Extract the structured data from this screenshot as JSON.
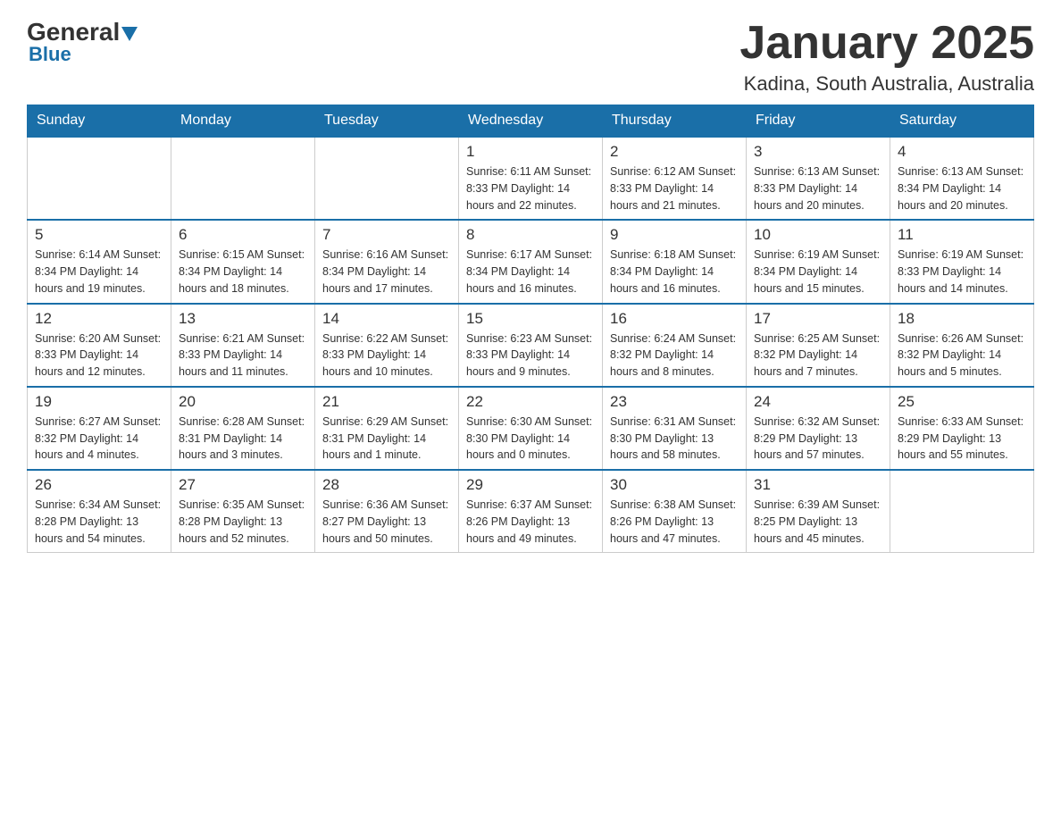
{
  "header": {
    "logo_general": "General",
    "logo_blue": "Blue",
    "title": "January 2025",
    "subtitle": "Kadina, South Australia, Australia"
  },
  "days_of_week": [
    "Sunday",
    "Monday",
    "Tuesday",
    "Wednesday",
    "Thursday",
    "Friday",
    "Saturday"
  ],
  "weeks": [
    {
      "cells": [
        {
          "day": "",
          "info": ""
        },
        {
          "day": "",
          "info": ""
        },
        {
          "day": "",
          "info": ""
        },
        {
          "day": "1",
          "info": "Sunrise: 6:11 AM\nSunset: 8:33 PM\nDaylight: 14 hours\nand 22 minutes."
        },
        {
          "day": "2",
          "info": "Sunrise: 6:12 AM\nSunset: 8:33 PM\nDaylight: 14 hours\nand 21 minutes."
        },
        {
          "day": "3",
          "info": "Sunrise: 6:13 AM\nSunset: 8:33 PM\nDaylight: 14 hours\nand 20 minutes."
        },
        {
          "day": "4",
          "info": "Sunrise: 6:13 AM\nSunset: 8:34 PM\nDaylight: 14 hours\nand 20 minutes."
        }
      ]
    },
    {
      "cells": [
        {
          "day": "5",
          "info": "Sunrise: 6:14 AM\nSunset: 8:34 PM\nDaylight: 14 hours\nand 19 minutes."
        },
        {
          "day": "6",
          "info": "Sunrise: 6:15 AM\nSunset: 8:34 PM\nDaylight: 14 hours\nand 18 minutes."
        },
        {
          "day": "7",
          "info": "Sunrise: 6:16 AM\nSunset: 8:34 PM\nDaylight: 14 hours\nand 17 minutes."
        },
        {
          "day": "8",
          "info": "Sunrise: 6:17 AM\nSunset: 8:34 PM\nDaylight: 14 hours\nand 16 minutes."
        },
        {
          "day": "9",
          "info": "Sunrise: 6:18 AM\nSunset: 8:34 PM\nDaylight: 14 hours\nand 16 minutes."
        },
        {
          "day": "10",
          "info": "Sunrise: 6:19 AM\nSunset: 8:34 PM\nDaylight: 14 hours\nand 15 minutes."
        },
        {
          "day": "11",
          "info": "Sunrise: 6:19 AM\nSunset: 8:33 PM\nDaylight: 14 hours\nand 14 minutes."
        }
      ]
    },
    {
      "cells": [
        {
          "day": "12",
          "info": "Sunrise: 6:20 AM\nSunset: 8:33 PM\nDaylight: 14 hours\nand 12 minutes."
        },
        {
          "day": "13",
          "info": "Sunrise: 6:21 AM\nSunset: 8:33 PM\nDaylight: 14 hours\nand 11 minutes."
        },
        {
          "day": "14",
          "info": "Sunrise: 6:22 AM\nSunset: 8:33 PM\nDaylight: 14 hours\nand 10 minutes."
        },
        {
          "day": "15",
          "info": "Sunrise: 6:23 AM\nSunset: 8:33 PM\nDaylight: 14 hours\nand 9 minutes."
        },
        {
          "day": "16",
          "info": "Sunrise: 6:24 AM\nSunset: 8:32 PM\nDaylight: 14 hours\nand 8 minutes."
        },
        {
          "day": "17",
          "info": "Sunrise: 6:25 AM\nSunset: 8:32 PM\nDaylight: 14 hours\nand 7 minutes."
        },
        {
          "day": "18",
          "info": "Sunrise: 6:26 AM\nSunset: 8:32 PM\nDaylight: 14 hours\nand 5 minutes."
        }
      ]
    },
    {
      "cells": [
        {
          "day": "19",
          "info": "Sunrise: 6:27 AM\nSunset: 8:32 PM\nDaylight: 14 hours\nand 4 minutes."
        },
        {
          "day": "20",
          "info": "Sunrise: 6:28 AM\nSunset: 8:31 PM\nDaylight: 14 hours\nand 3 minutes."
        },
        {
          "day": "21",
          "info": "Sunrise: 6:29 AM\nSunset: 8:31 PM\nDaylight: 14 hours\nand 1 minute."
        },
        {
          "day": "22",
          "info": "Sunrise: 6:30 AM\nSunset: 8:30 PM\nDaylight: 14 hours\nand 0 minutes."
        },
        {
          "day": "23",
          "info": "Sunrise: 6:31 AM\nSunset: 8:30 PM\nDaylight: 13 hours\nand 58 minutes."
        },
        {
          "day": "24",
          "info": "Sunrise: 6:32 AM\nSunset: 8:29 PM\nDaylight: 13 hours\nand 57 minutes."
        },
        {
          "day": "25",
          "info": "Sunrise: 6:33 AM\nSunset: 8:29 PM\nDaylight: 13 hours\nand 55 minutes."
        }
      ]
    },
    {
      "cells": [
        {
          "day": "26",
          "info": "Sunrise: 6:34 AM\nSunset: 8:28 PM\nDaylight: 13 hours\nand 54 minutes."
        },
        {
          "day": "27",
          "info": "Sunrise: 6:35 AM\nSunset: 8:28 PM\nDaylight: 13 hours\nand 52 minutes."
        },
        {
          "day": "28",
          "info": "Sunrise: 6:36 AM\nSunset: 8:27 PM\nDaylight: 13 hours\nand 50 minutes."
        },
        {
          "day": "29",
          "info": "Sunrise: 6:37 AM\nSunset: 8:26 PM\nDaylight: 13 hours\nand 49 minutes."
        },
        {
          "day": "30",
          "info": "Sunrise: 6:38 AM\nSunset: 8:26 PM\nDaylight: 13 hours\nand 47 minutes."
        },
        {
          "day": "31",
          "info": "Sunrise: 6:39 AM\nSunset: 8:25 PM\nDaylight: 13 hours\nand 45 minutes."
        },
        {
          "day": "",
          "info": ""
        }
      ]
    }
  ]
}
